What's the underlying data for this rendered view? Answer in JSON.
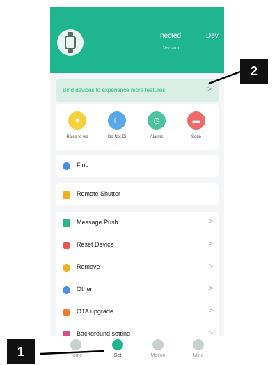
{
  "header": {
    "status": "nected",
    "device_label": "Dev",
    "version_label": "Version"
  },
  "bind_bar": {
    "text": "Bind devices to experience more features",
    "chevron": ">"
  },
  "quick_actions": [
    {
      "label": "Raise to wa",
      "icon": "raise-to-wake-icon",
      "color": "#f5d23c"
    },
    {
      "label": "Do Not Di",
      "icon": "do-not-disturb-icon",
      "color": "#5aa7e8"
    },
    {
      "label": "Alarms",
      "icon": "alarm-icon",
      "color": "#4cc2a0"
    },
    {
      "label": "Sede",
      "icon": "sedentary-icon",
      "color": "#f06a6a"
    }
  ],
  "rows": {
    "find": "Find",
    "remote_shutter": "Remote Shutter",
    "message_push": "Message Push",
    "reset_device": "Reset Device",
    "remove": "Remove",
    "other": "Other",
    "ota_upgrade": "OTA upgrade",
    "background_setting": "Background setting",
    "chevron": ">"
  },
  "tabs": [
    "Home",
    "Set",
    "Motion",
    "Mine"
  ],
  "callouts": {
    "one": "1",
    "two": "2"
  }
}
